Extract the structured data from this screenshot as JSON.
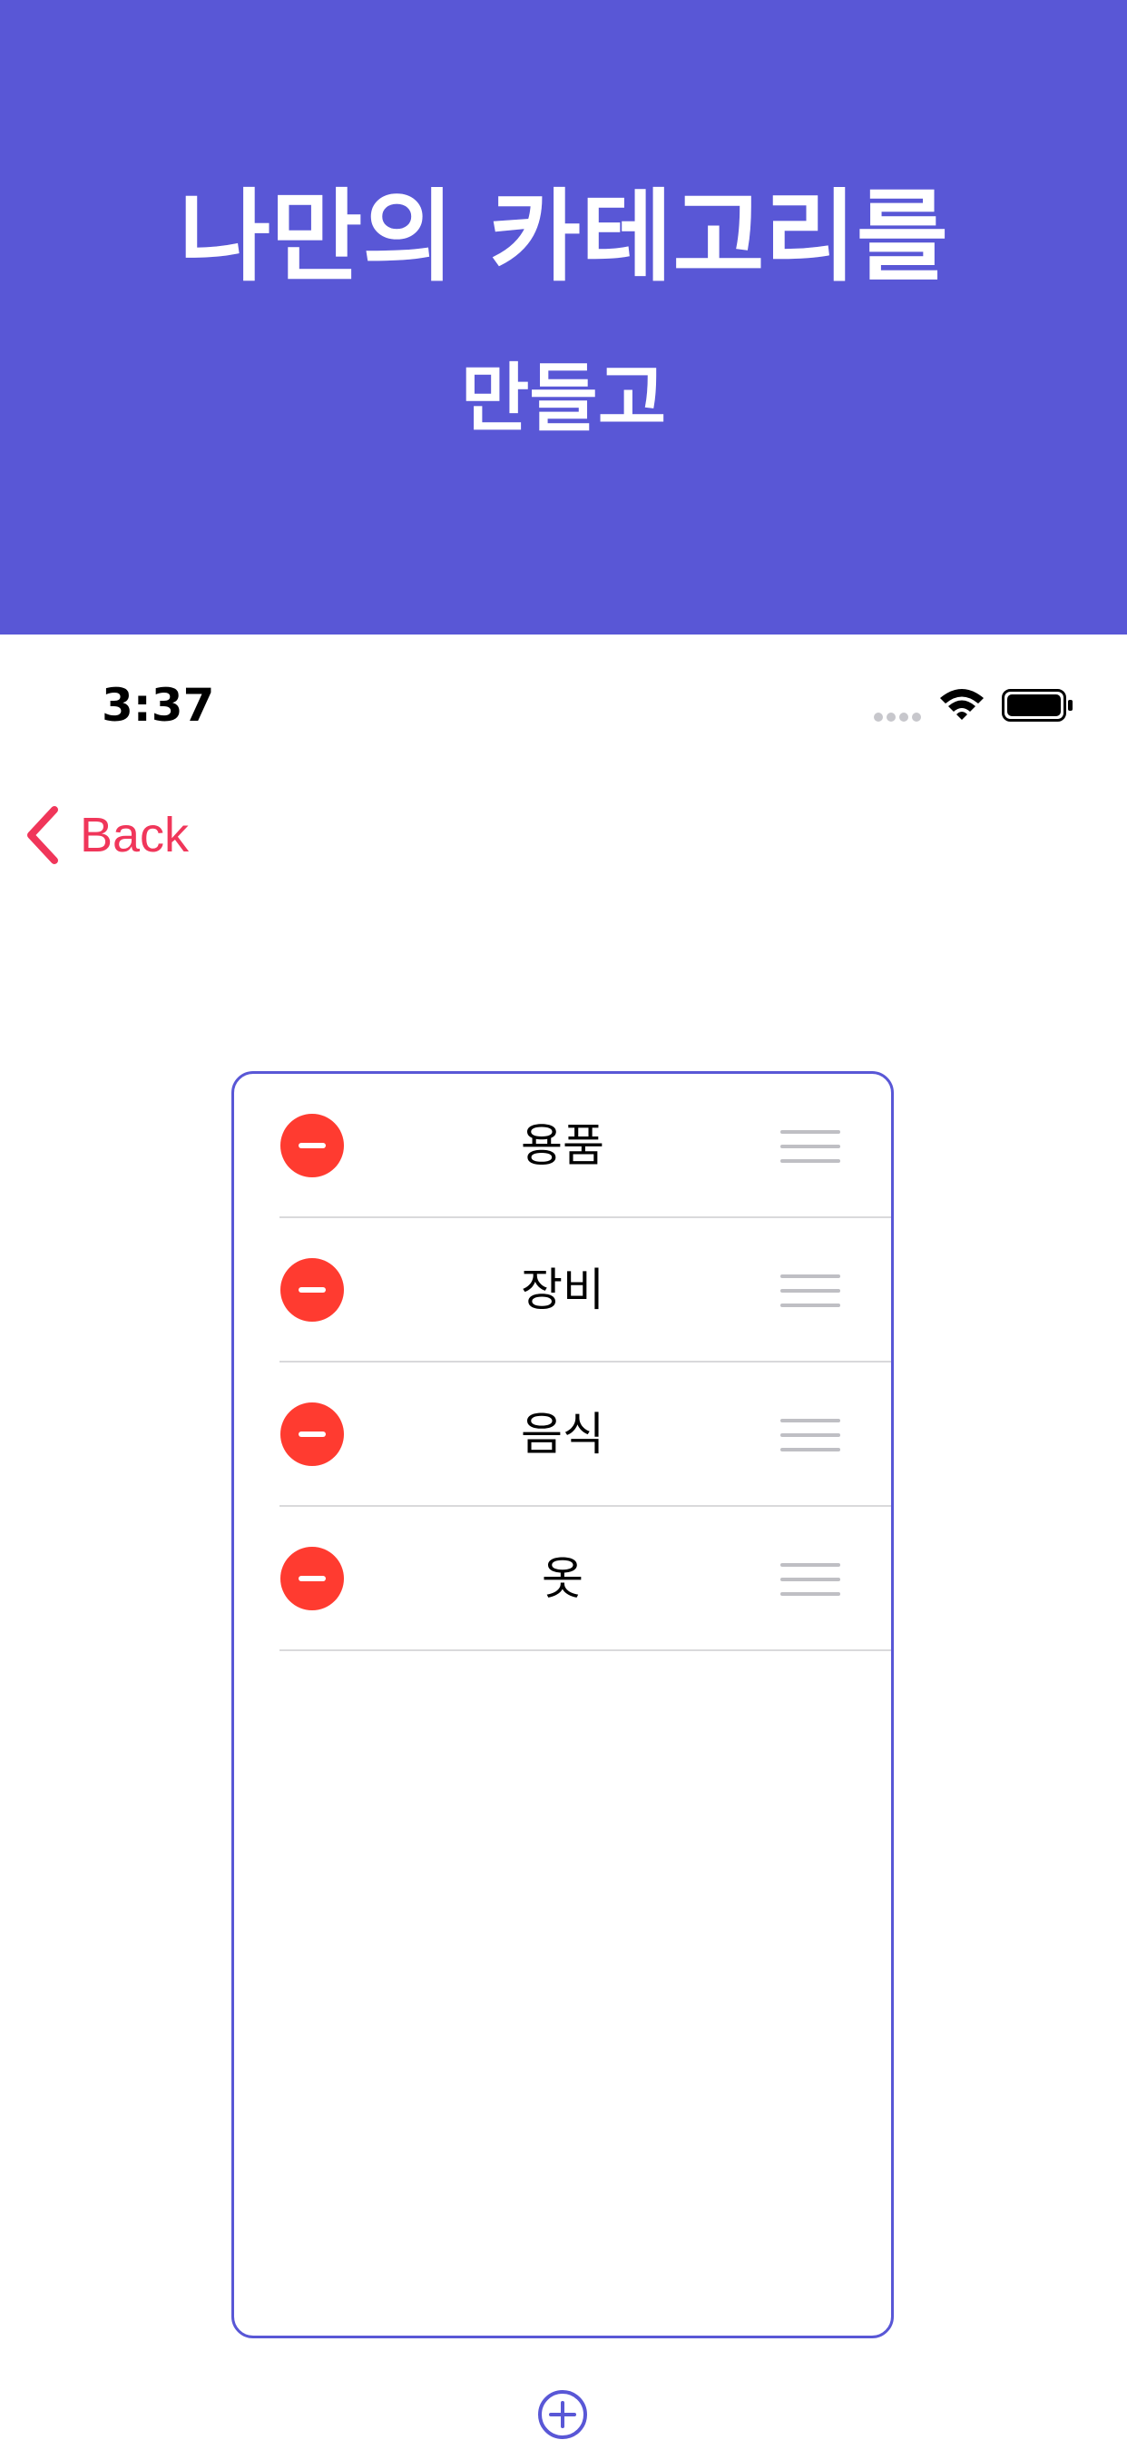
{
  "promo": {
    "title": "나만의 카테고리를",
    "subtitle": "만들고",
    "background_color": "#5957d6"
  },
  "status_bar": {
    "time": "3:37",
    "icons": [
      "signal-dots-icon",
      "wifi-icon",
      "battery-icon"
    ]
  },
  "nav": {
    "back_label": "Back",
    "back_icon": "chevron-left-icon",
    "accent_color": "#f0365a"
  },
  "category_list": {
    "border_color": "#5957d6",
    "items": [
      {
        "label": "용품"
      },
      {
        "label": "장비"
      },
      {
        "label": "음식"
      },
      {
        "label": "옷"
      }
    ],
    "row_icons": [
      "minus-circle-icon",
      "reorder-handle-icon"
    ],
    "delete_color": "#ff3b30"
  },
  "add_button": {
    "icon": "plus-circle-icon"
  }
}
